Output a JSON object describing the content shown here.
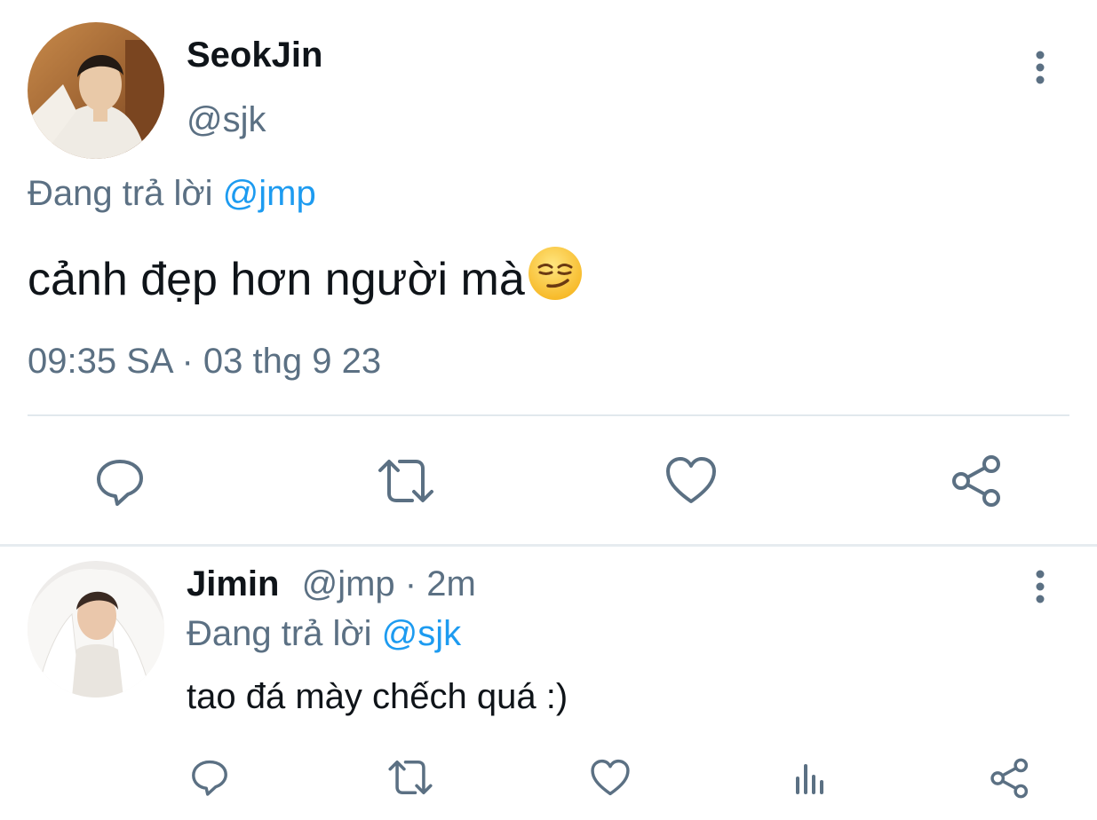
{
  "main_tweet": {
    "display_name": "SeokJin",
    "handle": "@sjk",
    "replying_prefix": "Đang trả lời",
    "replying_to": "@jmp",
    "text": "cảnh đẹp hơn người mà",
    "emoji": "smirking-face",
    "timestamp": "09:35 SA · 03 thg 9 23",
    "actions": [
      "reply-icon",
      "retweet-icon",
      "like-icon",
      "share-icon"
    ]
  },
  "reply_tweet": {
    "display_name": "Jimin",
    "handle": "@jmp",
    "separator": "·",
    "age": "2m",
    "replying_prefix": "Đang trả lời",
    "replying_to": "@sjk",
    "text": "tao đá mày chếch quá :)",
    "actions": [
      "reply-icon",
      "retweet-icon",
      "like-icon",
      "analytics-icon",
      "share-icon"
    ]
  },
  "colors": {
    "text_primary": "#0f1419",
    "text_muted": "#5b7083",
    "link": "#1d9bf0",
    "divider": "#e1e8ed"
  }
}
